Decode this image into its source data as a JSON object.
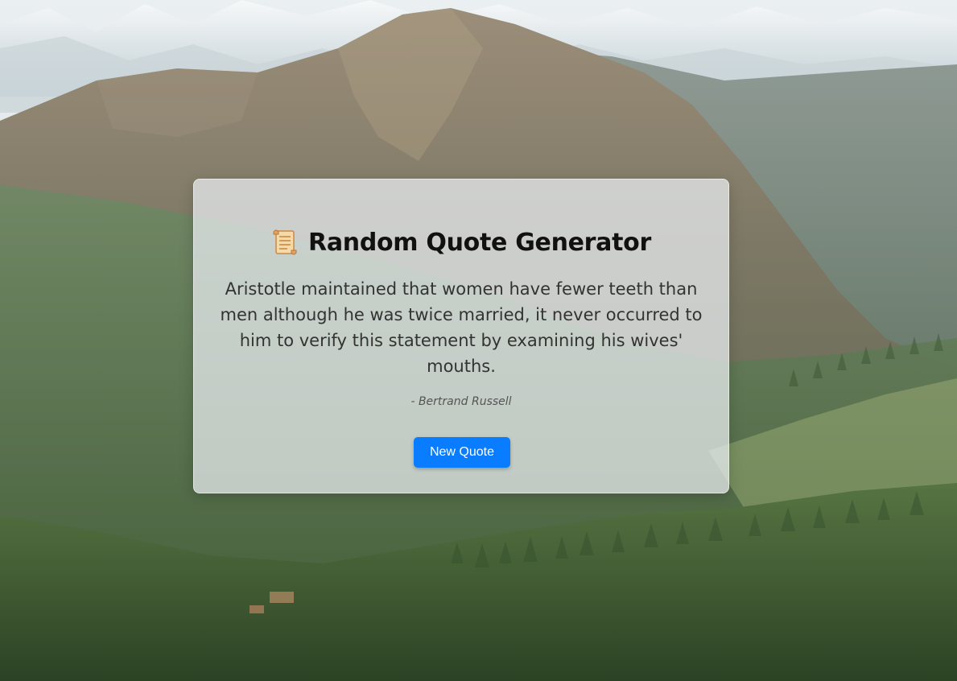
{
  "page": {
    "title": "Random Quote Generator",
    "title_icon": "scroll-icon"
  },
  "quote": {
    "text": "Aristotle maintained that women have fewer teeth than men although he was twice married, it never occurred to him to verify this statement by examining his wives' mouths.",
    "author": "- Bertrand Russell"
  },
  "actions": {
    "new_quote_label": "New Quote"
  },
  "colors": {
    "button_bg": "#0a7cff",
    "card_bg": "rgba(236,240,244,0.72)",
    "title_text": "#111111",
    "quote_text": "#333333"
  },
  "background": {
    "image": "mountain-landscape"
  }
}
